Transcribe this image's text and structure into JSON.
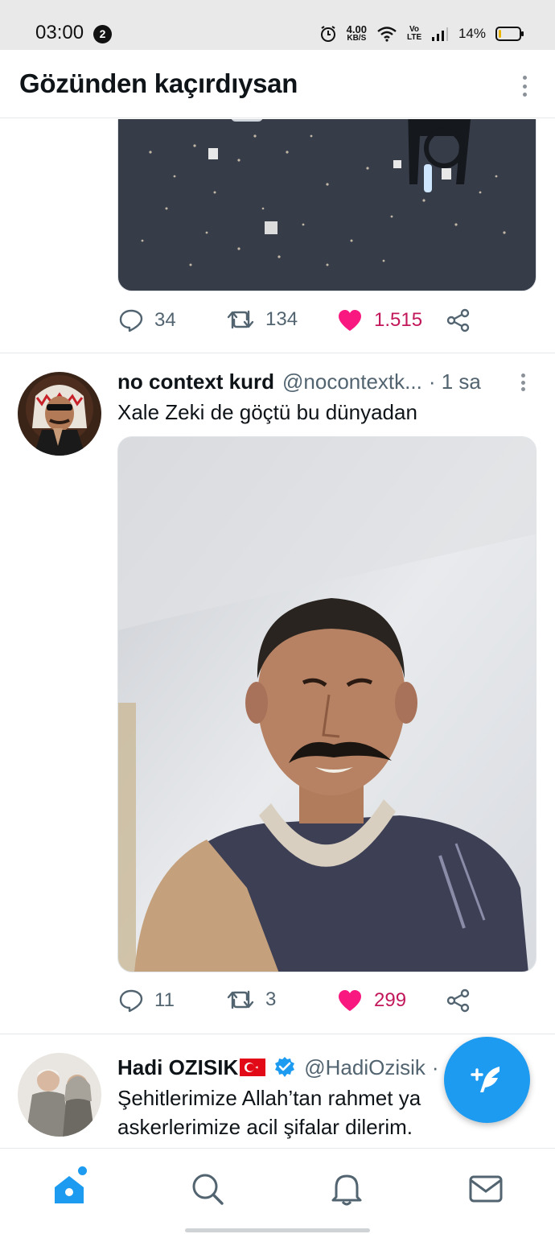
{
  "status_bar": {
    "time": "03:00",
    "notification_count": "2",
    "speed_value": "4.00",
    "speed_unit": "KB/S",
    "network_label": "Vo LTE",
    "battery_percent": "14%",
    "battery_level": 0.14
  },
  "header": {
    "title": "Gözünden kaçırdıysan"
  },
  "tweets": [
    {
      "replies": "34",
      "retweets": "134",
      "likes": "1.515"
    },
    {
      "name": "no context kurd",
      "handle": "@nocontextk...",
      "time": "· 1 sa",
      "text": "Xale Zeki de göçtü bu dünyadan",
      "replies": "11",
      "retweets": "3",
      "likes": "299"
    },
    {
      "name": "Hadi OZISIK",
      "handle": "@HadiOzisik",
      "time": "·",
      "text_line1": "Şehitlerimize Allah’tan rahmet ya",
      "text_line2": "askerlerimize acil şifalar dilerim."
    }
  ],
  "colors": {
    "accent": "#1d9bf0",
    "like": "#f91880",
    "muted": "#536471"
  },
  "nav": [
    "home-icon",
    "search-icon",
    "bell-icon",
    "mail-icon"
  ]
}
